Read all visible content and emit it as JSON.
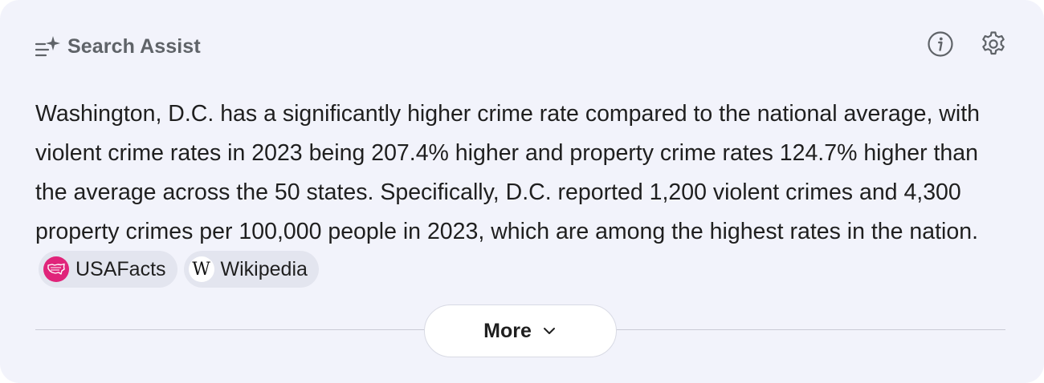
{
  "header": {
    "title": "Search Assist",
    "icon": "sparkle-list-icon",
    "info_icon": "info-icon",
    "settings_icon": "gear-icon"
  },
  "answer": {
    "text": "Washington, D.C. has a significantly higher crime rate compared to the national average, with violent crime rates in 2023 being 207.4% higher and property crime rates 124.7% higher than the average across the 50 states. Specifically, D.C. reported 1,200 violent crimes and 4,300 property crimes per 100,000 people in 2023, which are among the highest rates in the nation.",
    "sources": [
      {
        "label": "USAFacts",
        "icon": "usafacts-logo-icon",
        "color": "#e0247a"
      },
      {
        "label": "Wikipedia",
        "icon": "wikipedia-logo-icon",
        "glyph": "W"
      }
    ]
  },
  "more_button": {
    "label": "More",
    "icon": "chevron-down-icon"
  },
  "colors": {
    "card_background": "#f2f3fb",
    "chip_background": "#e3e5ef",
    "usafacts_brand": "#e0247a"
  }
}
